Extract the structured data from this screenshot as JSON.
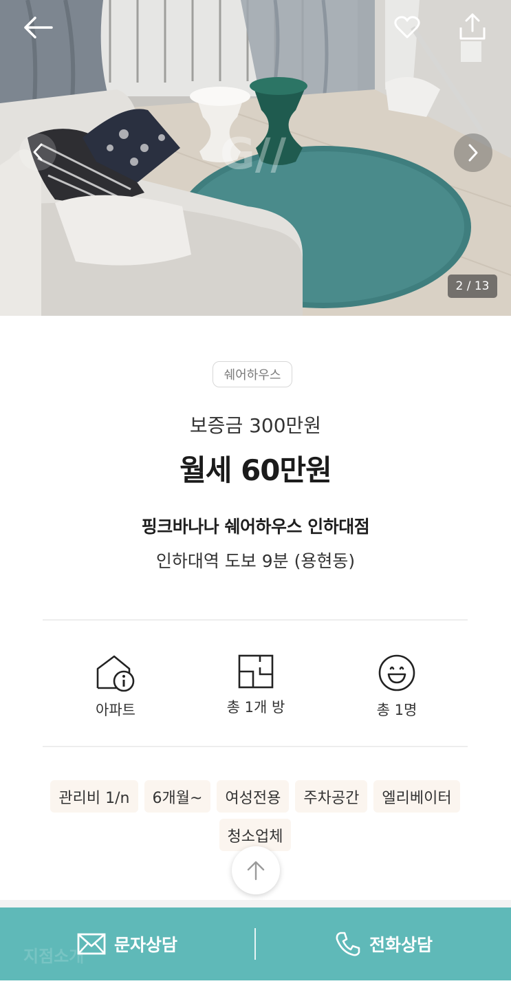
{
  "gallery": {
    "counter": "2 / 13",
    "watermark": "G//",
    "icons": [
      "arrow-left-icon",
      "heart-icon",
      "share-icon",
      "chevron-left-icon",
      "chevron-right-icon"
    ]
  },
  "listing": {
    "type_badge": "쉐어하우스",
    "deposit": "보증금 300만원",
    "rent": "월세 60만원",
    "name": "핑크바나나 쉐어하우스 인하대점",
    "location": "인하대역 도보 9분 (용현동)"
  },
  "specs": [
    {
      "icon": "house-info-icon",
      "label": "아파트"
    },
    {
      "icon": "floorplan-icon",
      "label": "총 1개 방"
    },
    {
      "icon": "smiley-icon",
      "label": "총 1명"
    }
  ],
  "tags": [
    "관리비 1/n",
    "6개월~",
    "여성전용",
    "주차공간",
    "엘리베이터",
    "청소업체"
  ],
  "bottom_bar": {
    "ghost_text": "지점소개",
    "sms_label": "문자상담",
    "call_label": "전화상담"
  },
  "colors": {
    "accent": "#5fb9b8",
    "tag_bg": "#fbf5ef"
  }
}
